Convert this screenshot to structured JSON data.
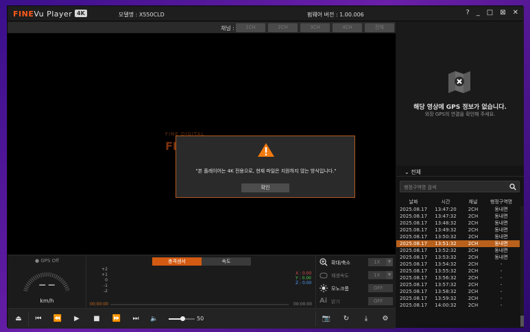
{
  "app": {
    "logo_brand": "FINE",
    "logo_product": "Vu Player 2.0",
    "badge": "4K",
    "model": "모델명 : X550CLD",
    "firmware": "펌웨어 버전 : 1.00.006",
    "window_controls": [
      "?",
      "_",
      "□",
      "⊠",
      "✕"
    ]
  },
  "channels": {
    "label": "채널 :",
    "buttons": [
      "1CH",
      "2CH",
      "3CH",
      "4CH",
      "전체"
    ]
  },
  "video": {
    "brand_small": "FINE DIGITAL",
    "brand_big": "FINE"
  },
  "dialog": {
    "message": "\"본 플레이어는 4K 전용으로, 현재 파일은 지원하지 않는 방식입니다.\"",
    "ok_label": "확인"
  },
  "gps": {
    "title": "해당 영상에 GPS 정보가 없습니다.",
    "subtitle": "외장 GPS의 연결을 확인해 주세요."
  },
  "filelist": {
    "all_label": "전체",
    "search_placeholder": "행정구역명 검색",
    "headers": [
      "날짜",
      "시간",
      "채널",
      "행정구역명"
    ],
    "rows": [
      [
        "2025.08.17",
        "13:47:20",
        "2CH",
        "동내면"
      ],
      [
        "2025.08.17",
        "13:47:32",
        "2CH",
        "동내면"
      ],
      [
        "2025.08.17",
        "13:48:32",
        "2CH",
        "동내면"
      ],
      [
        "2025.08.17",
        "13:49:32",
        "2CH",
        "동내면"
      ],
      [
        "2025.08.17",
        "13:50:32",
        "2CH",
        "동내면"
      ],
      [
        "2025.08.17",
        "13:51:32",
        "2CH",
        "동내면"
      ],
      [
        "2025.08.17",
        "13:52:32",
        "2CH",
        "동내면"
      ],
      [
        "2025.08.17",
        "13:53:32",
        "2CH",
        "동내면"
      ],
      [
        "2025.08.17",
        "13:54:32",
        "2CH",
        "-"
      ],
      [
        "2025.08.17",
        "13:55:32",
        "2CH",
        "-"
      ],
      [
        "2025.08.17",
        "13:56:32",
        "2CH",
        "-"
      ],
      [
        "2025.08.17",
        "13:57:32",
        "2CH",
        "-"
      ],
      [
        "2025.08.17",
        "13:58:32",
        "2CH",
        "-"
      ],
      [
        "2025.08.17",
        "13:59:32",
        "2CH",
        "-"
      ],
      [
        "2025.08.17",
        "14:00:32",
        "2CH",
        "-"
      ]
    ],
    "selected_index": 5
  },
  "speedometer": {
    "gps_status": "GPS Off",
    "value": "— —",
    "unit": "km/h"
  },
  "graph": {
    "tab_impact": "충격센서",
    "tab_speed": "속도",
    "y_labels": [
      "+2",
      "+1",
      "0",
      "-1",
      "-2"
    ],
    "x_readout": "X : 0.00",
    "y_readout": "Y : 0.00",
    "z_readout": "Z : 0.00",
    "time_start": "00:00:00",
    "time_end": "00:00:00"
  },
  "options": [
    {
      "label": "확대/축소",
      "value": "1X",
      "enabled": true
    },
    {
      "label": "재생속도",
      "value": "1X",
      "enabled": false
    },
    {
      "label": "모노크롬",
      "value": "OFF",
      "enabled": true
    },
    {
      "label": "밝기",
      "value": "OFF",
      "enabled": false
    }
  ],
  "volume": {
    "value": "50"
  },
  "colors": {
    "accent": "#d35a12",
    "brand": "#ff5a1a",
    "selected_row": "#b8601c"
  }
}
